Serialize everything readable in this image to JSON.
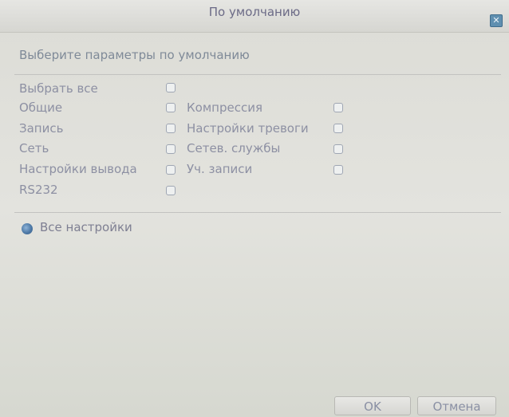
{
  "dialog": {
    "title": "По умолчанию",
    "heading": "Выберите параметры по умолчанию"
  },
  "left_items": [
    {
      "label": "Выбрать все",
      "checked": false
    },
    {
      "label": "Общие",
      "checked": false
    },
    {
      "label": "Запись",
      "checked": false
    },
    {
      "label": "Сеть",
      "checked": false
    },
    {
      "label": "Настройки вывода",
      "checked": false
    },
    {
      "label": "RS232",
      "checked": false
    }
  ],
  "right_items": [
    {
      "label": "Компрессия",
      "checked": false
    },
    {
      "label": "Настройки тревоги",
      "checked": false
    },
    {
      "label": "Сетев. службы",
      "checked": false
    },
    {
      "label": "Уч. записи",
      "checked": false
    }
  ],
  "radio": {
    "label": "Все настройки",
    "selected": true
  },
  "buttons": {
    "ok": "OK",
    "cancel": "Отмена"
  },
  "colors": {
    "text": "#8d90a3",
    "accent": "#5f8fb0"
  }
}
